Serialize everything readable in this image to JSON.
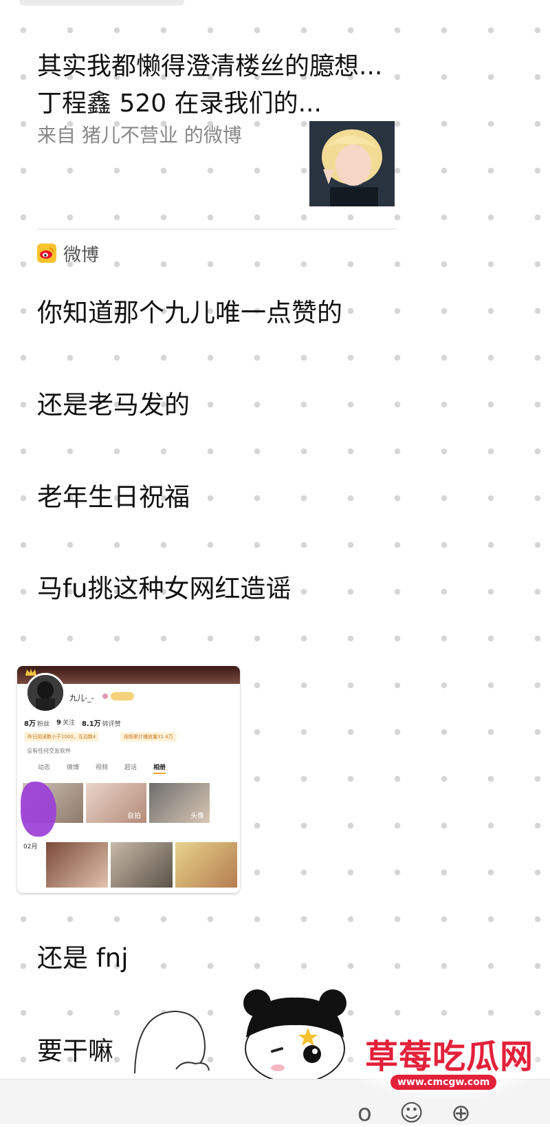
{
  "share_card": {
    "title": "其实我都懒得澄清楼丝的臆想...丁程鑫 520 在录我们的...",
    "source": "来自 猪儿不营业 的微博",
    "app_name": "微博"
  },
  "messages": [
    "你知道那个九儿唯一点赞的",
    "还是老马发的",
    "老年生日祝福",
    "马fu挑这种女网红造谣",
    "还是 fnj",
    "要干嘛"
  ],
  "embedded_profile": {
    "name": "九儿-_-",
    "stats": [
      {
        "value": "8万",
        "label": "粉丝"
      },
      {
        "value": "9",
        "label": "关注"
      },
      {
        "value": "8.1万",
        "label": "转评赞"
      }
    ],
    "tags": [
      "昨日阅读数小于1000，互动数4",
      "视频累计播放量31.4万"
    ],
    "note": "没有任何交友软件",
    "tabs": [
      "动态",
      "微博",
      "视频",
      "超话",
      "相册"
    ],
    "active_tab": "相册",
    "photo_labels": [
      "自拍",
      "头像"
    ],
    "month": "02月"
  },
  "watermark": {
    "text": "草莓吃瓜网",
    "url": "www.cmcgw.com"
  },
  "colors": {
    "accent": "#e4213a",
    "weibo": "#f7c32e"
  }
}
